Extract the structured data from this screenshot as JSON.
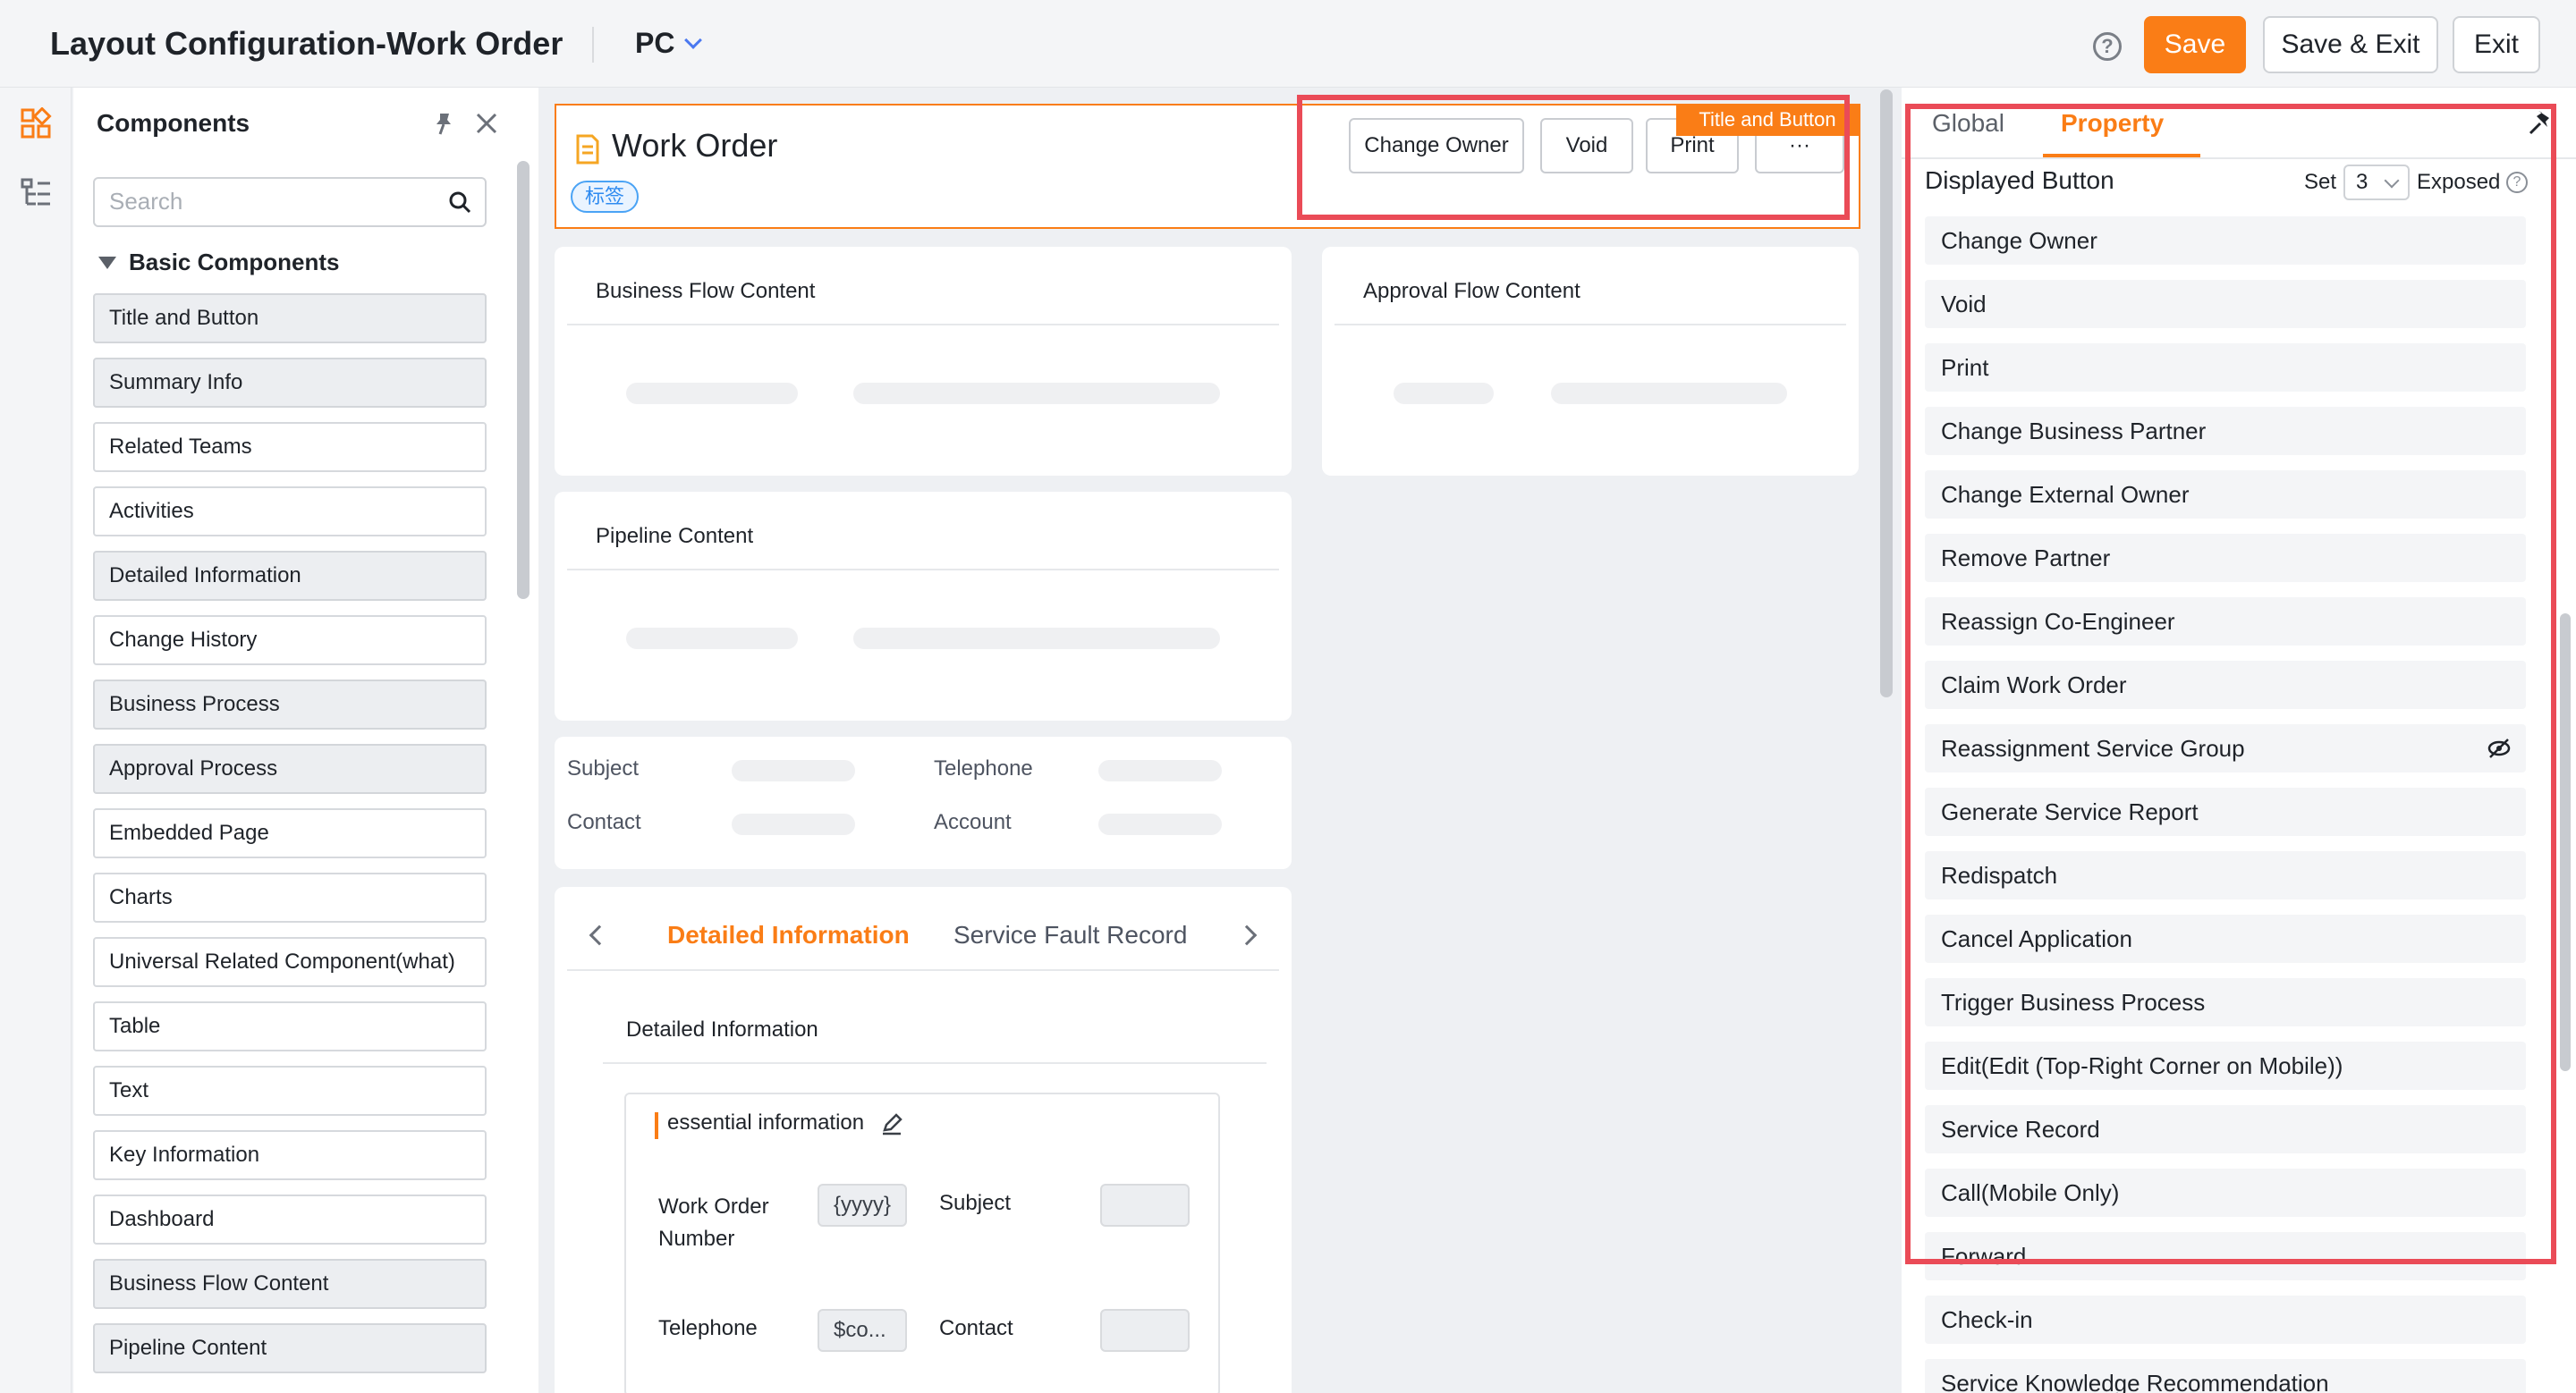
{
  "header": {
    "title": "Layout Configuration-Work Order",
    "platform": "PC",
    "save": "Save",
    "save_exit": "Save & Exit",
    "exit": "Exit"
  },
  "components": {
    "title": "Components",
    "search_placeholder": "Search",
    "group": "Basic Components",
    "items": [
      {
        "label": "Title and Button",
        "used": true
      },
      {
        "label": "Summary Info",
        "used": true
      },
      {
        "label": "Related Teams",
        "used": false
      },
      {
        "label": "Activities",
        "used": false
      },
      {
        "label": "Detailed Information",
        "used": true
      },
      {
        "label": "Change History",
        "used": false
      },
      {
        "label": "Business Process",
        "used": true
      },
      {
        "label": "Approval Process",
        "used": true
      },
      {
        "label": "Embedded Page",
        "used": false
      },
      {
        "label": "Charts",
        "used": false
      },
      {
        "label": "Universal Related Component(what)",
        "used": false
      },
      {
        "label": "Table",
        "used": false
      },
      {
        "label": "Text",
        "used": false
      },
      {
        "label": "Key Information",
        "used": false
      },
      {
        "label": "Dashboard",
        "used": false
      },
      {
        "label": "Business Flow Content",
        "used": true
      },
      {
        "label": "Pipeline Content",
        "used": true
      }
    ]
  },
  "canvas": {
    "record_title": "Work Order",
    "tag": "标签",
    "buttons": [
      "Change Owner",
      "Void",
      "Print",
      "···"
    ],
    "component_badge": "Title and Button",
    "business_flow": "Business Flow Content",
    "approval_flow": "Approval Flow Content",
    "pipeline": "Pipeline Content",
    "summary_fields": [
      "Subject",
      "Telephone",
      "Contact",
      "Account"
    ],
    "tabs": [
      "Detailed Information",
      "Service Fault Record"
    ],
    "detail_title": "Detailed Information",
    "essential": "essential information",
    "fields": {
      "work_order_number": "Work Order Number",
      "wo_value": "{yyyy}",
      "subject": "Subject",
      "telephone": "Telephone",
      "tel_value": "$co...",
      "contact": "Contact"
    }
  },
  "property_panel": {
    "tab_global": "Global",
    "tab_property": "Property",
    "displayed_button": "Displayed Button",
    "set_label": "Set",
    "set_value": "3",
    "exposed_label": "Exposed",
    "buttons": [
      "Change Owner",
      "Void",
      "Print",
      "Change Business Partner",
      "Change External Owner",
      "Remove Partner",
      "Reassign Co-Engineer",
      "Claim Work Order",
      "Reassignment Service Group",
      "Generate Service Report",
      "Redispatch",
      "Cancel Application",
      "Trigger Business Process",
      "Edit(Edit (Top-Right Corner on Mobile))",
      "Service Record",
      "Call(Mobile Only)",
      "Forward",
      "Check-in",
      "Service Knowledge Recommendation"
    ],
    "hidden_button": "Reassignment Service Group"
  },
  "colors": {
    "accent": "#fa7d16",
    "highlight_box": "#ea4b57",
    "tag": "#2f8bf0"
  }
}
